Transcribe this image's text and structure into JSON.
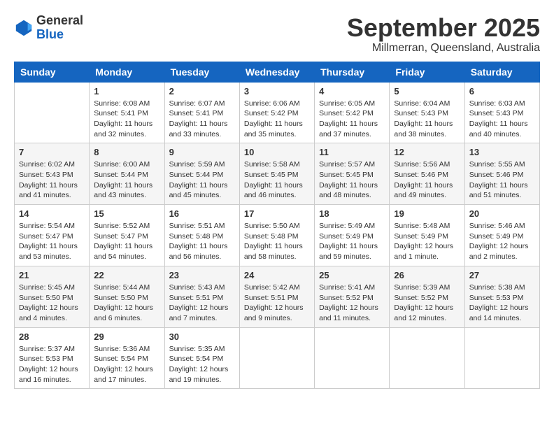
{
  "logo": {
    "general": "General",
    "blue": "Blue"
  },
  "header": {
    "month": "September 2025",
    "location": "Millmerran, Queensland, Australia"
  },
  "weekdays": [
    "Sunday",
    "Monday",
    "Tuesday",
    "Wednesday",
    "Thursday",
    "Friday",
    "Saturday"
  ],
  "weeks": [
    [
      {
        "day": "",
        "info": ""
      },
      {
        "day": "1",
        "info": "Sunrise: 6:08 AM\nSunset: 5:41 PM\nDaylight: 11 hours\nand 32 minutes."
      },
      {
        "day": "2",
        "info": "Sunrise: 6:07 AM\nSunset: 5:41 PM\nDaylight: 11 hours\nand 33 minutes."
      },
      {
        "day": "3",
        "info": "Sunrise: 6:06 AM\nSunset: 5:42 PM\nDaylight: 11 hours\nand 35 minutes."
      },
      {
        "day": "4",
        "info": "Sunrise: 6:05 AM\nSunset: 5:42 PM\nDaylight: 11 hours\nand 37 minutes."
      },
      {
        "day": "5",
        "info": "Sunrise: 6:04 AM\nSunset: 5:43 PM\nDaylight: 11 hours\nand 38 minutes."
      },
      {
        "day": "6",
        "info": "Sunrise: 6:03 AM\nSunset: 5:43 PM\nDaylight: 11 hours\nand 40 minutes."
      }
    ],
    [
      {
        "day": "7",
        "info": "Sunrise: 6:02 AM\nSunset: 5:43 PM\nDaylight: 11 hours\nand 41 minutes."
      },
      {
        "day": "8",
        "info": "Sunrise: 6:00 AM\nSunset: 5:44 PM\nDaylight: 11 hours\nand 43 minutes."
      },
      {
        "day": "9",
        "info": "Sunrise: 5:59 AM\nSunset: 5:44 PM\nDaylight: 11 hours\nand 45 minutes."
      },
      {
        "day": "10",
        "info": "Sunrise: 5:58 AM\nSunset: 5:45 PM\nDaylight: 11 hours\nand 46 minutes."
      },
      {
        "day": "11",
        "info": "Sunrise: 5:57 AM\nSunset: 5:45 PM\nDaylight: 11 hours\nand 48 minutes."
      },
      {
        "day": "12",
        "info": "Sunrise: 5:56 AM\nSunset: 5:46 PM\nDaylight: 11 hours\nand 49 minutes."
      },
      {
        "day": "13",
        "info": "Sunrise: 5:55 AM\nSunset: 5:46 PM\nDaylight: 11 hours\nand 51 minutes."
      }
    ],
    [
      {
        "day": "14",
        "info": "Sunrise: 5:54 AM\nSunset: 5:47 PM\nDaylight: 11 hours\nand 53 minutes."
      },
      {
        "day": "15",
        "info": "Sunrise: 5:52 AM\nSunset: 5:47 PM\nDaylight: 11 hours\nand 54 minutes."
      },
      {
        "day": "16",
        "info": "Sunrise: 5:51 AM\nSunset: 5:48 PM\nDaylight: 11 hours\nand 56 minutes."
      },
      {
        "day": "17",
        "info": "Sunrise: 5:50 AM\nSunset: 5:48 PM\nDaylight: 11 hours\nand 58 minutes."
      },
      {
        "day": "18",
        "info": "Sunrise: 5:49 AM\nSunset: 5:49 PM\nDaylight: 11 hours\nand 59 minutes."
      },
      {
        "day": "19",
        "info": "Sunrise: 5:48 AM\nSunset: 5:49 PM\nDaylight: 12 hours\nand 1 minute."
      },
      {
        "day": "20",
        "info": "Sunrise: 5:46 AM\nSunset: 5:49 PM\nDaylight: 12 hours\nand 2 minutes."
      }
    ],
    [
      {
        "day": "21",
        "info": "Sunrise: 5:45 AM\nSunset: 5:50 PM\nDaylight: 12 hours\nand 4 minutes."
      },
      {
        "day": "22",
        "info": "Sunrise: 5:44 AM\nSunset: 5:50 PM\nDaylight: 12 hours\nand 6 minutes."
      },
      {
        "day": "23",
        "info": "Sunrise: 5:43 AM\nSunset: 5:51 PM\nDaylight: 12 hours\nand 7 minutes."
      },
      {
        "day": "24",
        "info": "Sunrise: 5:42 AM\nSunset: 5:51 PM\nDaylight: 12 hours\nand 9 minutes."
      },
      {
        "day": "25",
        "info": "Sunrise: 5:41 AM\nSunset: 5:52 PM\nDaylight: 12 hours\nand 11 minutes."
      },
      {
        "day": "26",
        "info": "Sunrise: 5:39 AM\nSunset: 5:52 PM\nDaylight: 12 hours\nand 12 minutes."
      },
      {
        "day": "27",
        "info": "Sunrise: 5:38 AM\nSunset: 5:53 PM\nDaylight: 12 hours\nand 14 minutes."
      }
    ],
    [
      {
        "day": "28",
        "info": "Sunrise: 5:37 AM\nSunset: 5:53 PM\nDaylight: 12 hours\nand 16 minutes."
      },
      {
        "day": "29",
        "info": "Sunrise: 5:36 AM\nSunset: 5:54 PM\nDaylight: 12 hours\nand 17 minutes."
      },
      {
        "day": "30",
        "info": "Sunrise: 5:35 AM\nSunset: 5:54 PM\nDaylight: 12 hours\nand 19 minutes."
      },
      {
        "day": "",
        "info": ""
      },
      {
        "day": "",
        "info": ""
      },
      {
        "day": "",
        "info": ""
      },
      {
        "day": "",
        "info": ""
      }
    ]
  ]
}
